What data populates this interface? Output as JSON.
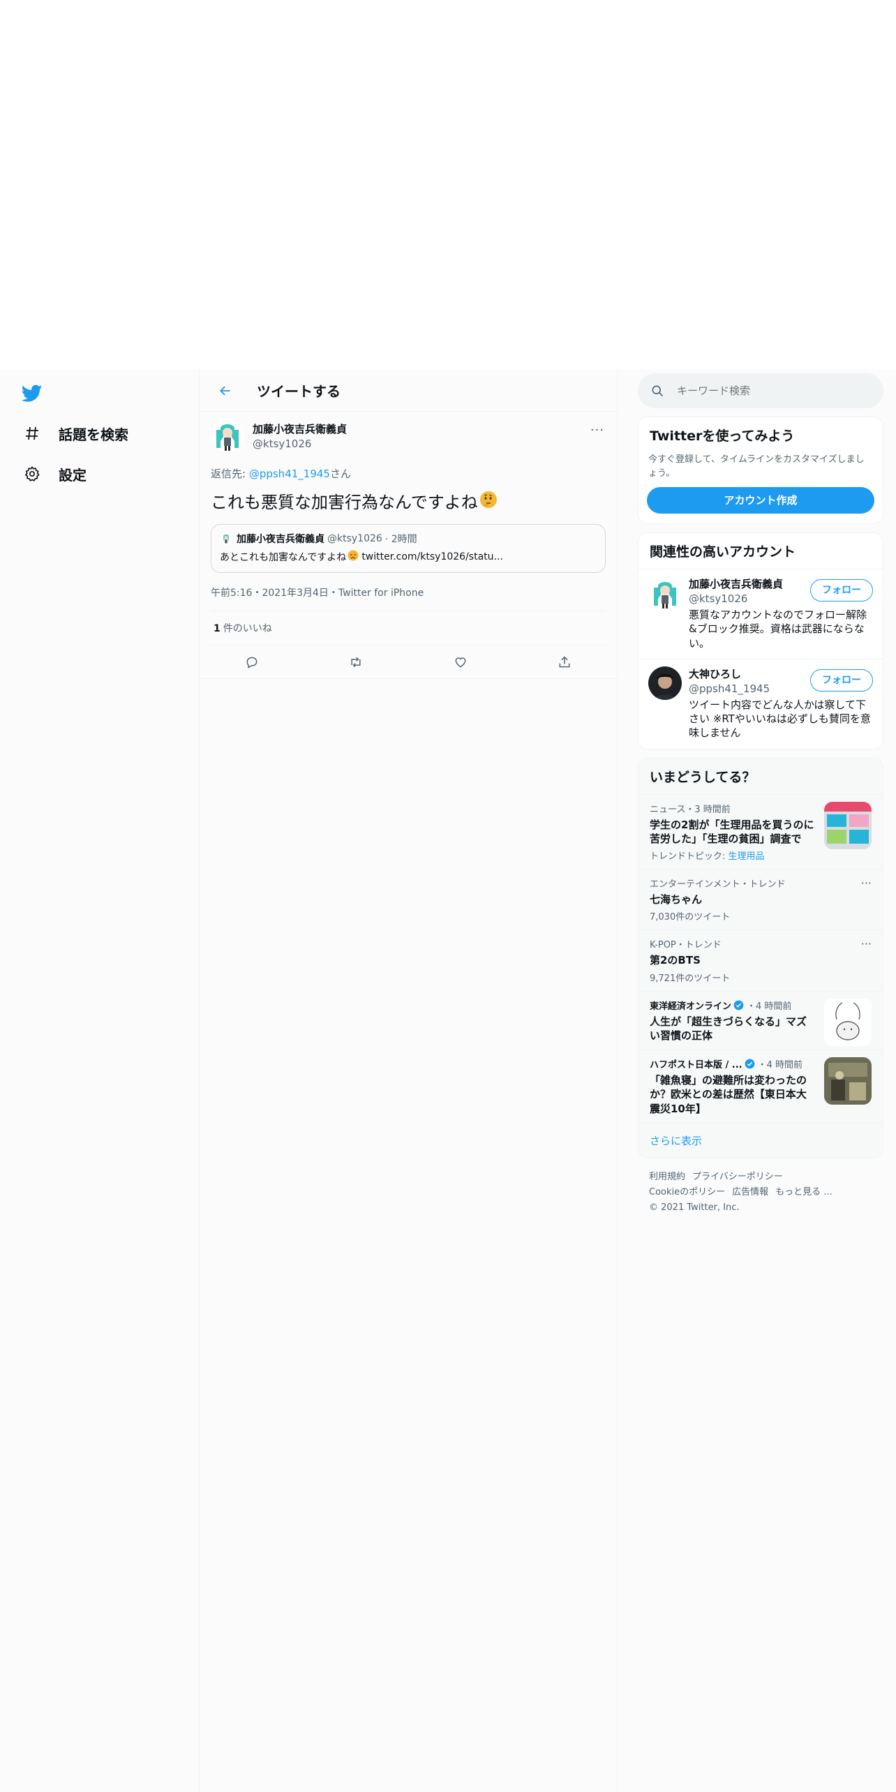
{
  "nav": {
    "logo": "twitter-logo",
    "items": [
      {
        "label": "話題を検索",
        "icon": "hashtag-icon"
      },
      {
        "label": "設定",
        "icon": "gear-icon"
      }
    ]
  },
  "main": {
    "title": "ツイートする",
    "tweet": {
      "name": "加藤小夜吉兵衛義貞",
      "handle": "@ktsy1026",
      "reply_prefix": "返信先: ",
      "reply_handle": "@ppsh41_1945",
      "reply_suffix": "さん",
      "text": "これも悪質な加害行為なんですよね",
      "quote": {
        "name": "加藤小夜吉兵衛義貞",
        "handle": "@ktsy1026",
        "time": "· 2時間",
        "text": "あとこれも加害なんですよね",
        "link": "twitter.com/ktsy1026/statu..."
      },
      "meta": "午前5:16・2021年3月4日・Twitter for iPhone",
      "likes_count": "1",
      "likes_label": "件のいいね"
    }
  },
  "sidebar": {
    "search_placeholder": "キーワード検索",
    "signup": {
      "title": "Twitterを使ってみよう",
      "desc": "今すぐ登録して、タイムラインをカスタマイズしましょう。",
      "button": "アカウント作成"
    },
    "related": {
      "title": "関連性の高いアカウント",
      "accounts": [
        {
          "name": "加藤小夜吉兵衛義貞",
          "handle": "@ktsy1026",
          "desc": "悪質なアカウントなのでフォロー解除&ブロック推奨。資格は武器にならない。",
          "follow": "フォロー"
        },
        {
          "name": "大神ひろし",
          "handle": "@ppsh41_1945",
          "desc": "ツイート内容でどんな人かは察して下さい ※RTやいいねは必ずしも賛同を意味しません",
          "follow": "フォロー"
        }
      ]
    },
    "trends": {
      "title": "いまどうしてる？",
      "items": [
        {
          "meta": "ニュース・3 時間前",
          "name": "学生の2割が「生理用品を買うのに苦労した」「生理の貧困」調査で",
          "sub_prefix": "トレンドトピック: ",
          "sub_link": "生理用品"
        },
        {
          "meta": "エンターテインメント・トレンド",
          "name": "七海ちゃん",
          "sub": "7,030件のツイート"
        },
        {
          "meta": "K-POP・トレンド",
          "name": "第2のBTS",
          "sub": "9,721件のツイート"
        },
        {
          "source": "東洋経済オンライン",
          "time": "・4 時間前",
          "name": "人生が「超生きづらくなる」マズい習慣の正体"
        },
        {
          "source": "ハフポスト日本版 / ...",
          "time": "・4 時間前",
          "name": "「雑魚寝」の避難所は変わったのか？欧米との差は歴然【東日本大震災10年】"
        }
      ],
      "show_more": "さらに表示"
    },
    "footer": {
      "links1": [
        "利用規約",
        "プライバシーポリシー"
      ],
      "links2": [
        "Cookieのポリシー",
        "広告情報",
        "もっと見る ..."
      ],
      "copyright": "© 2021 Twitter, Inc."
    }
  },
  "colors": {
    "accent": "#1d9bf0",
    "text": "#0f1419",
    "muted": "#536471"
  }
}
